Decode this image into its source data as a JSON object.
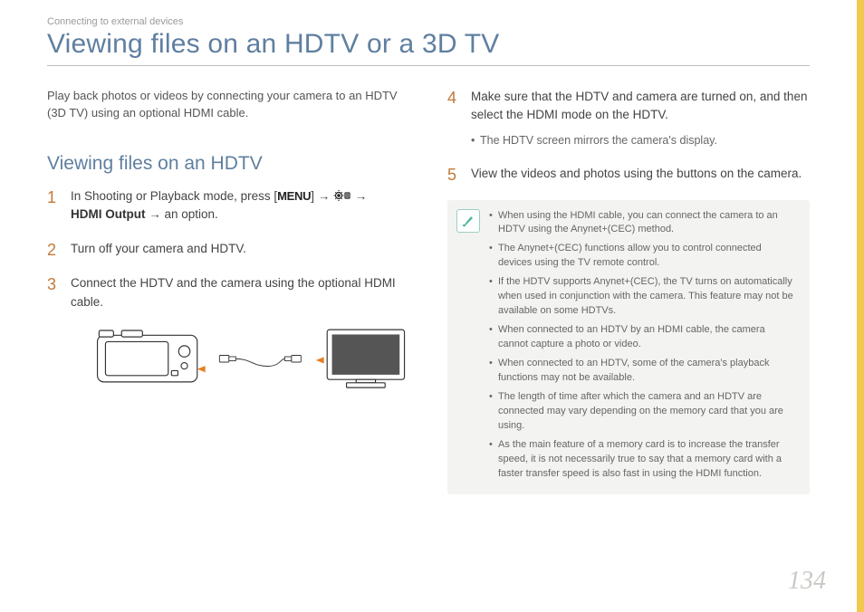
{
  "header": {
    "breadcrumb": "Connecting to external devices",
    "title": "Viewing files on an HDTV or a 3D TV"
  },
  "intro": "Play back photos or videos by connecting your camera to an HDTV (3D TV) using an optional HDMI cable.",
  "section_title": "Viewing files on an HDTV",
  "steps_left": {
    "s1_pre": "In Shooting or Playback mode, press [",
    "s1_menu": "MENU",
    "s1_mid1": "] → ",
    "s1_mid2": " → ",
    "s1_bold": "HDMI Output",
    "s1_post": " → an option.",
    "s2": "Turn off your camera and HDTV.",
    "s3": "Connect the HDTV and the camera using the optional HDMI cable."
  },
  "steps_right": {
    "s4": "Make sure that the HDTV and camera are turned on, and then select the HDMI mode on the HDTV.",
    "s4_sub": "The HDTV screen mirrors the camera's display.",
    "s5": "View the videos and photos using the buttons on the camera."
  },
  "notes": [
    "When using the HDMI cable, you can connect the camera to an HDTV using the Anynet+(CEC) method.",
    "The Anynet+(CEC) functions allow you to control connected devices using the TV remote control.",
    "If the HDTV supports Anynet+(CEC), the TV turns on automatically when used in conjunction with the camera. This feature may not be available on some HDTVs.",
    "When connected to an HDTV by an HDMI cable, the camera cannot capture a photo or video.",
    "When connected to an HDTV, some of the camera's playback functions may not be available.",
    "The length of time after which the camera and an HDTV are connected may vary depending on the memory card that you are using.",
    "As the main feature of a memory card is to increase the transfer speed, it is not necessarily true to say that a memory card with a faster transfer speed is also fast in using the HDMI function."
  ],
  "nums": {
    "n1": "1",
    "n2": "2",
    "n3": "3",
    "n4": "4",
    "n5": "5"
  },
  "page_number": "134"
}
